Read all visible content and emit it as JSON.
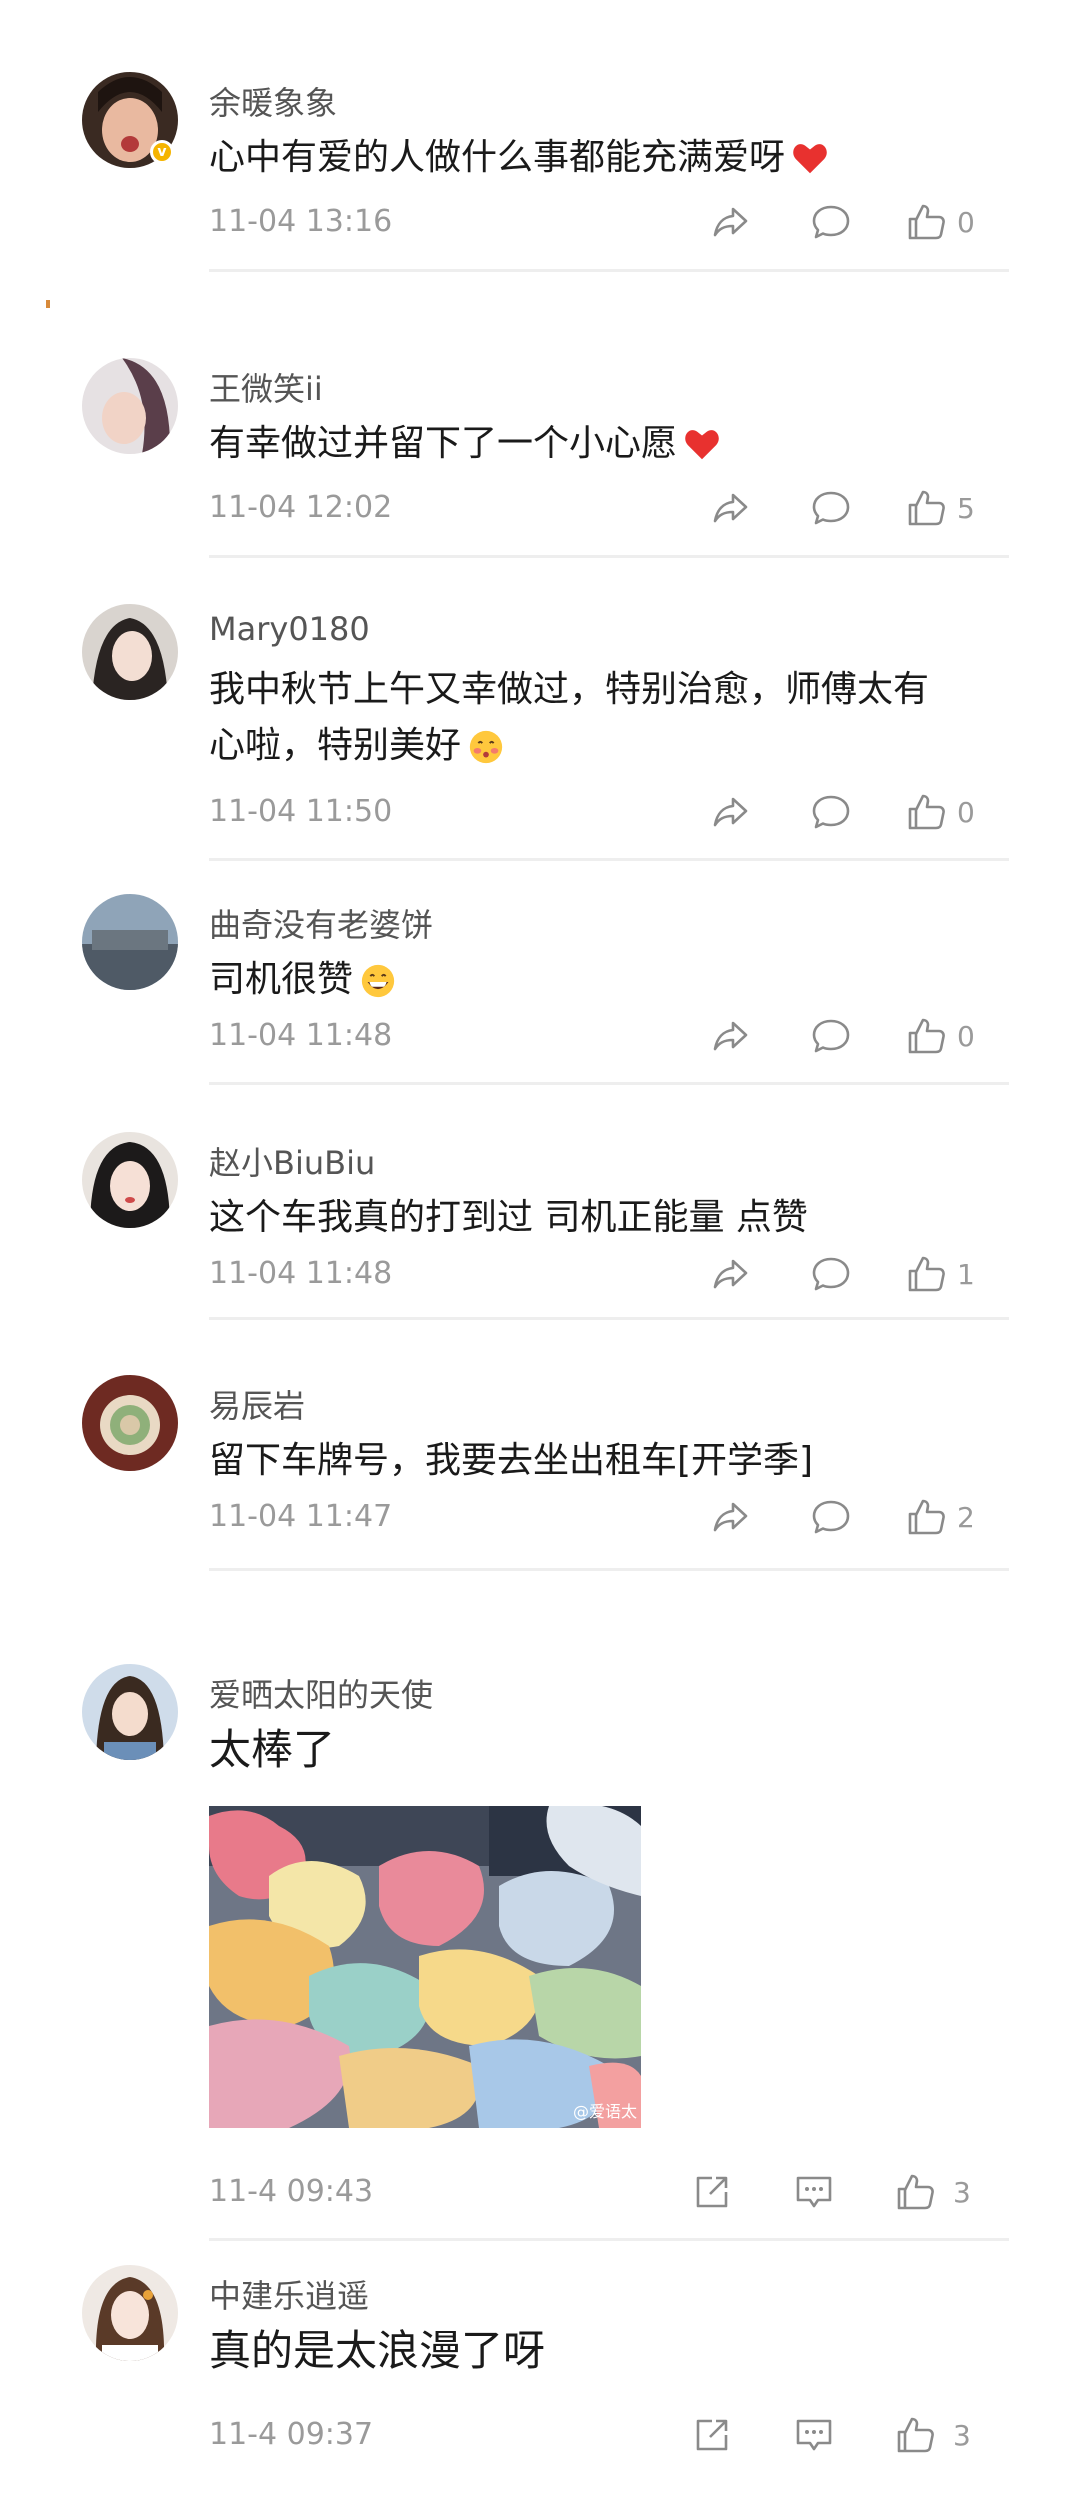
{
  "comments": [
    {
      "username": "余暖象象",
      "text": "心中有爱的人做什么事都能充满爱呀",
      "emoji": "heart",
      "time": "11-04 13:16",
      "likes": "0",
      "verified": true
    },
    {
      "username": "王微笑ii",
      "text": "有幸做过并留下了一个小心愿",
      "emoji": "heart",
      "time": "11-04 12:02",
      "likes": "5"
    },
    {
      "username": "Mary0180",
      "text_line1": "我中秋节上午又幸做过，特别治愈，师傅太有",
      "text_line2": "心啦，特别美好",
      "emoji": "blushing-face",
      "time": "11-04 11:50",
      "likes": "0"
    },
    {
      "username": "曲奇没有老婆饼",
      "text": "司机很赞",
      "emoji": "grinning-face",
      "time": "11-04 11:48",
      "likes": "0"
    },
    {
      "username": "赵小BiuBiu",
      "text": "这个车我真的打到过 司机正能量 点赞",
      "time": "11-04 11:48",
      "likes": "1"
    },
    {
      "username": "易辰岩",
      "text": "留下车牌号，我要去坐出租车[开学季]",
      "time": "11-04 11:47",
      "likes": "2"
    },
    {
      "username": "爱晒太阳的天使",
      "text": "太棒了",
      "time": "11-4 09:43",
      "likes": "3",
      "photo_watermark": "@爱语太"
    },
    {
      "username": "中建乐逍遥",
      "text": "真的是太浪漫了呀",
      "time": "11-4 09:37",
      "likes": "3"
    }
  ],
  "icons": {
    "share": "share-arrow-icon",
    "reply": "comment-bubble-icon",
    "like": "thumbs-up-icon",
    "repost": "repost-box-icon",
    "message": "message-box-icon"
  },
  "colors": {
    "heart": "#e8312f",
    "verified": "#f5b400",
    "meta_text": "#9a9a9a",
    "username": "#555555",
    "divider": "#eeeeee"
  }
}
